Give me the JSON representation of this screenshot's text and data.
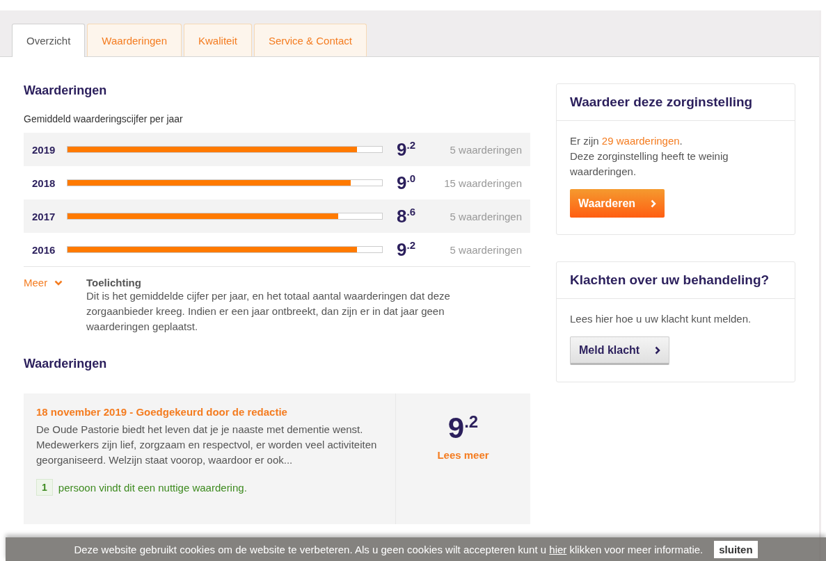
{
  "tabs": [
    {
      "label": "Overzicht",
      "selected": true
    },
    {
      "label": "Waarderingen",
      "selected": false
    },
    {
      "label": "Kwaliteit",
      "selected": false
    },
    {
      "label": "Service & Contact",
      "selected": false
    }
  ],
  "ratings_summary": {
    "title": "Waarderingen",
    "subtitle": "Gemiddeld waarderingscijfer per jaar",
    "years": [
      {
        "year": "2019",
        "level": 0.92,
        "score": "9",
        "decimal": ".2",
        "count": "5 waarderingen"
      },
      {
        "year": "2018",
        "level": 0.9,
        "score": "9",
        "decimal": ".0",
        "count": "15 waarderingen"
      },
      {
        "year": "2017",
        "level": 0.86,
        "score": "8",
        "decimal": ".6",
        "count": "5 waarderingen"
      },
      {
        "year": "2016",
        "level": 0.92,
        "score": "9",
        "decimal": ".2",
        "count": "5 waarderingen"
      }
    ],
    "more_label": "Meer",
    "explanation_title": "Toelichting",
    "explanation": "Dit is het gemiddelde cijfer per jaar, en het totaal aantal waarderingen dat deze zorgaanbieder kreeg. Indien er een jaar ontbreekt, dan zijn er in dat jaar geen waarderingen geplaatst."
  },
  "reviews": {
    "title": "Waarderingen",
    "items": [
      {
        "heading": "18 november 2019 - Goedgekeurd door de redactie",
        "text": "De Oude Pastorie biedt het leven dat je je naaste met dementie wenst. Medewerkers zijn lief, zorgzaam en respectvol, er worden veel activiteiten georganiseerd. Welzijn staat voorop, waardoor er ook...",
        "helpful_count": "1",
        "helpful_text": "persoon vindt dit een nuttige waardering.",
        "score": "9",
        "decimal": ".2",
        "link": "Lees meer"
      }
    ]
  },
  "sidebar": [
    {
      "kind": "rate",
      "title": "Waardeer deze zorginstelling",
      "intro": "Er zijn",
      "link": "29 waarderingen",
      "after": ".",
      "text": "Deze zorginstelling heeft te weinig waarderingen.",
      "button": "Waarderen"
    },
    {
      "kind": "complaint",
      "title": "Klachten over uw behandeling?",
      "text": "Lees hier hoe u uw klacht kunt melden.",
      "button": "Meld klacht"
    }
  ],
  "cookie_bar": {
    "text_before": "Deze website gebruikt cookies om de website te verbeteren. Als u geen cookies wilt accepteren kunt u",
    "link": "hier",
    "text_after": "klikken voor meer informatie.",
    "button": "sluiten"
  }
}
